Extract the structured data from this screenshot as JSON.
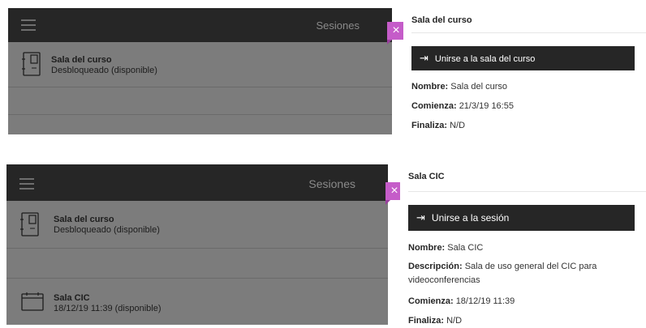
{
  "screens": [
    {
      "topbar_title": "Sesiones",
      "rows": [
        {
          "name": "Sala del curso",
          "status": "Desbloqueado (disponible)",
          "icon": "phone-book-icon"
        }
      ],
      "panel": {
        "title": "Sala del curso",
        "join_label": "Unirse a la sala del curso",
        "details": [
          {
            "label": "Nombre:",
            "value": "Sala del curso"
          },
          {
            "label": "Comienza:",
            "value": "21/3/19 16:55"
          },
          {
            "label": "Finaliza:",
            "value": "N/D"
          }
        ]
      },
      "close_glyph": "×"
    },
    {
      "topbar_title": "Sesiones",
      "rows": [
        {
          "name": "Sala del curso",
          "status": "Desbloqueado (disponible)",
          "icon": "phone-book-icon"
        },
        {
          "name": "Sala CIC",
          "status": "18/12/19 11:39 (disponible)",
          "icon": "calendar-icon"
        }
      ],
      "panel": {
        "title": "Sala CIC",
        "join_label": "Unirse a la sesión",
        "details": [
          {
            "label": "Nombre:",
            "value": "Sala CIC"
          },
          {
            "label": "Descripción:",
            "value": "Sala de uso general del CIC para videoconferencias"
          },
          {
            "label": "Comienza:",
            "value": "18/12/19 11:39"
          },
          {
            "label": "Finaliza:",
            "value": "N/D"
          }
        ]
      },
      "close_glyph": "×"
    }
  ],
  "icons": {
    "menu": "hamburger-menu-icon",
    "join": "enter-icon",
    "close": "close-icon"
  },
  "colors": {
    "topbar": "#262626",
    "overlay": "#7c7c7c",
    "accent": "#c55cc9",
    "button": "#262626"
  }
}
